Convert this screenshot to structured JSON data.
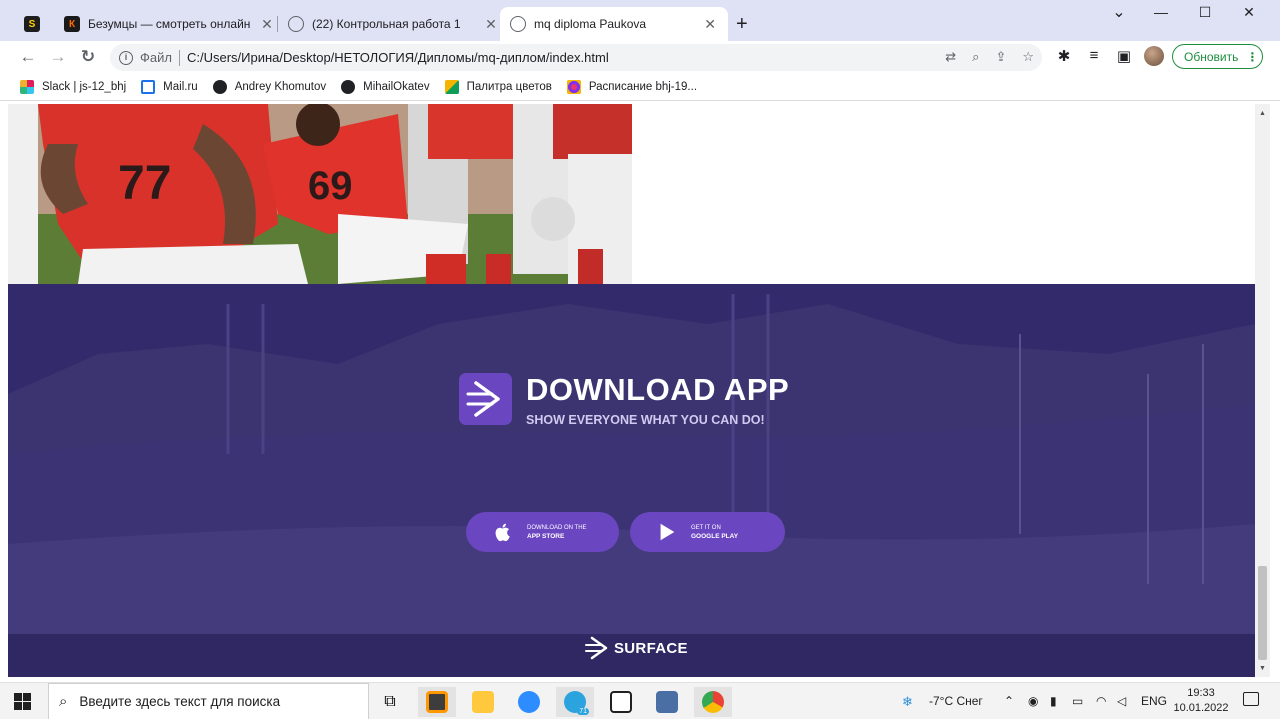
{
  "tabs": [
    {
      "title": "",
      "favicon": "s-favicon"
    },
    {
      "title": "Безумцы — смотреть онлайн в",
      "favicon": "kinopoisk-favicon"
    },
    {
      "title": "(22) Контрольная работа 1",
      "favicon": "globe-favicon"
    },
    {
      "title": "mq diploma Paukova",
      "favicon": "globe-favicon",
      "active": true
    }
  ],
  "window_controls": {
    "minimize": "—",
    "maximize": "☐",
    "close": "✕",
    "tab_menu": "⌄"
  },
  "address_bar": {
    "prefix": "Файл",
    "url": "C:/Users/Ирина/Desktop/НЕТОЛОГИЯ/Дипломы/mq-диплом/index.html"
  },
  "update_button": "Обновить",
  "bookmarks": [
    {
      "label": "Slack | js-12_bhj",
      "icon": "slack-icon"
    },
    {
      "label": "Mail.ru",
      "icon": "mail-icon"
    },
    {
      "label": "Andrey Khomutov",
      "icon": "github-icon"
    },
    {
      "label": "MihailOkatev",
      "icon": "github-icon"
    },
    {
      "label": "Палитра цветов",
      "icon": "palette-icon"
    },
    {
      "label": "Расписание bhj-19...",
      "icon": "schedule-icon"
    }
  ],
  "page": {
    "download": {
      "title": "DOWNLOAD APP",
      "subtitle": "SHOW EVERYONE WHAT YOU CAN DO!",
      "app_store": {
        "small": "DOWNLOAD ON THE",
        "big": "APP STORE"
      },
      "google_play": {
        "small": "GET IT ON",
        "big": "GOOGLE PLAY"
      },
      "brand": "SURFACE"
    },
    "colors": {
      "overlay": "#352d6e",
      "accent": "#6b46c1",
      "subtitle": "#d2c9f0"
    }
  },
  "taskbar": {
    "search_placeholder": "Введите здесь текст для поиска",
    "weather": "-7°C  Снег",
    "language": "ENG",
    "time": "19:33",
    "date": "10.01.2022",
    "telegram_badge": "71"
  }
}
